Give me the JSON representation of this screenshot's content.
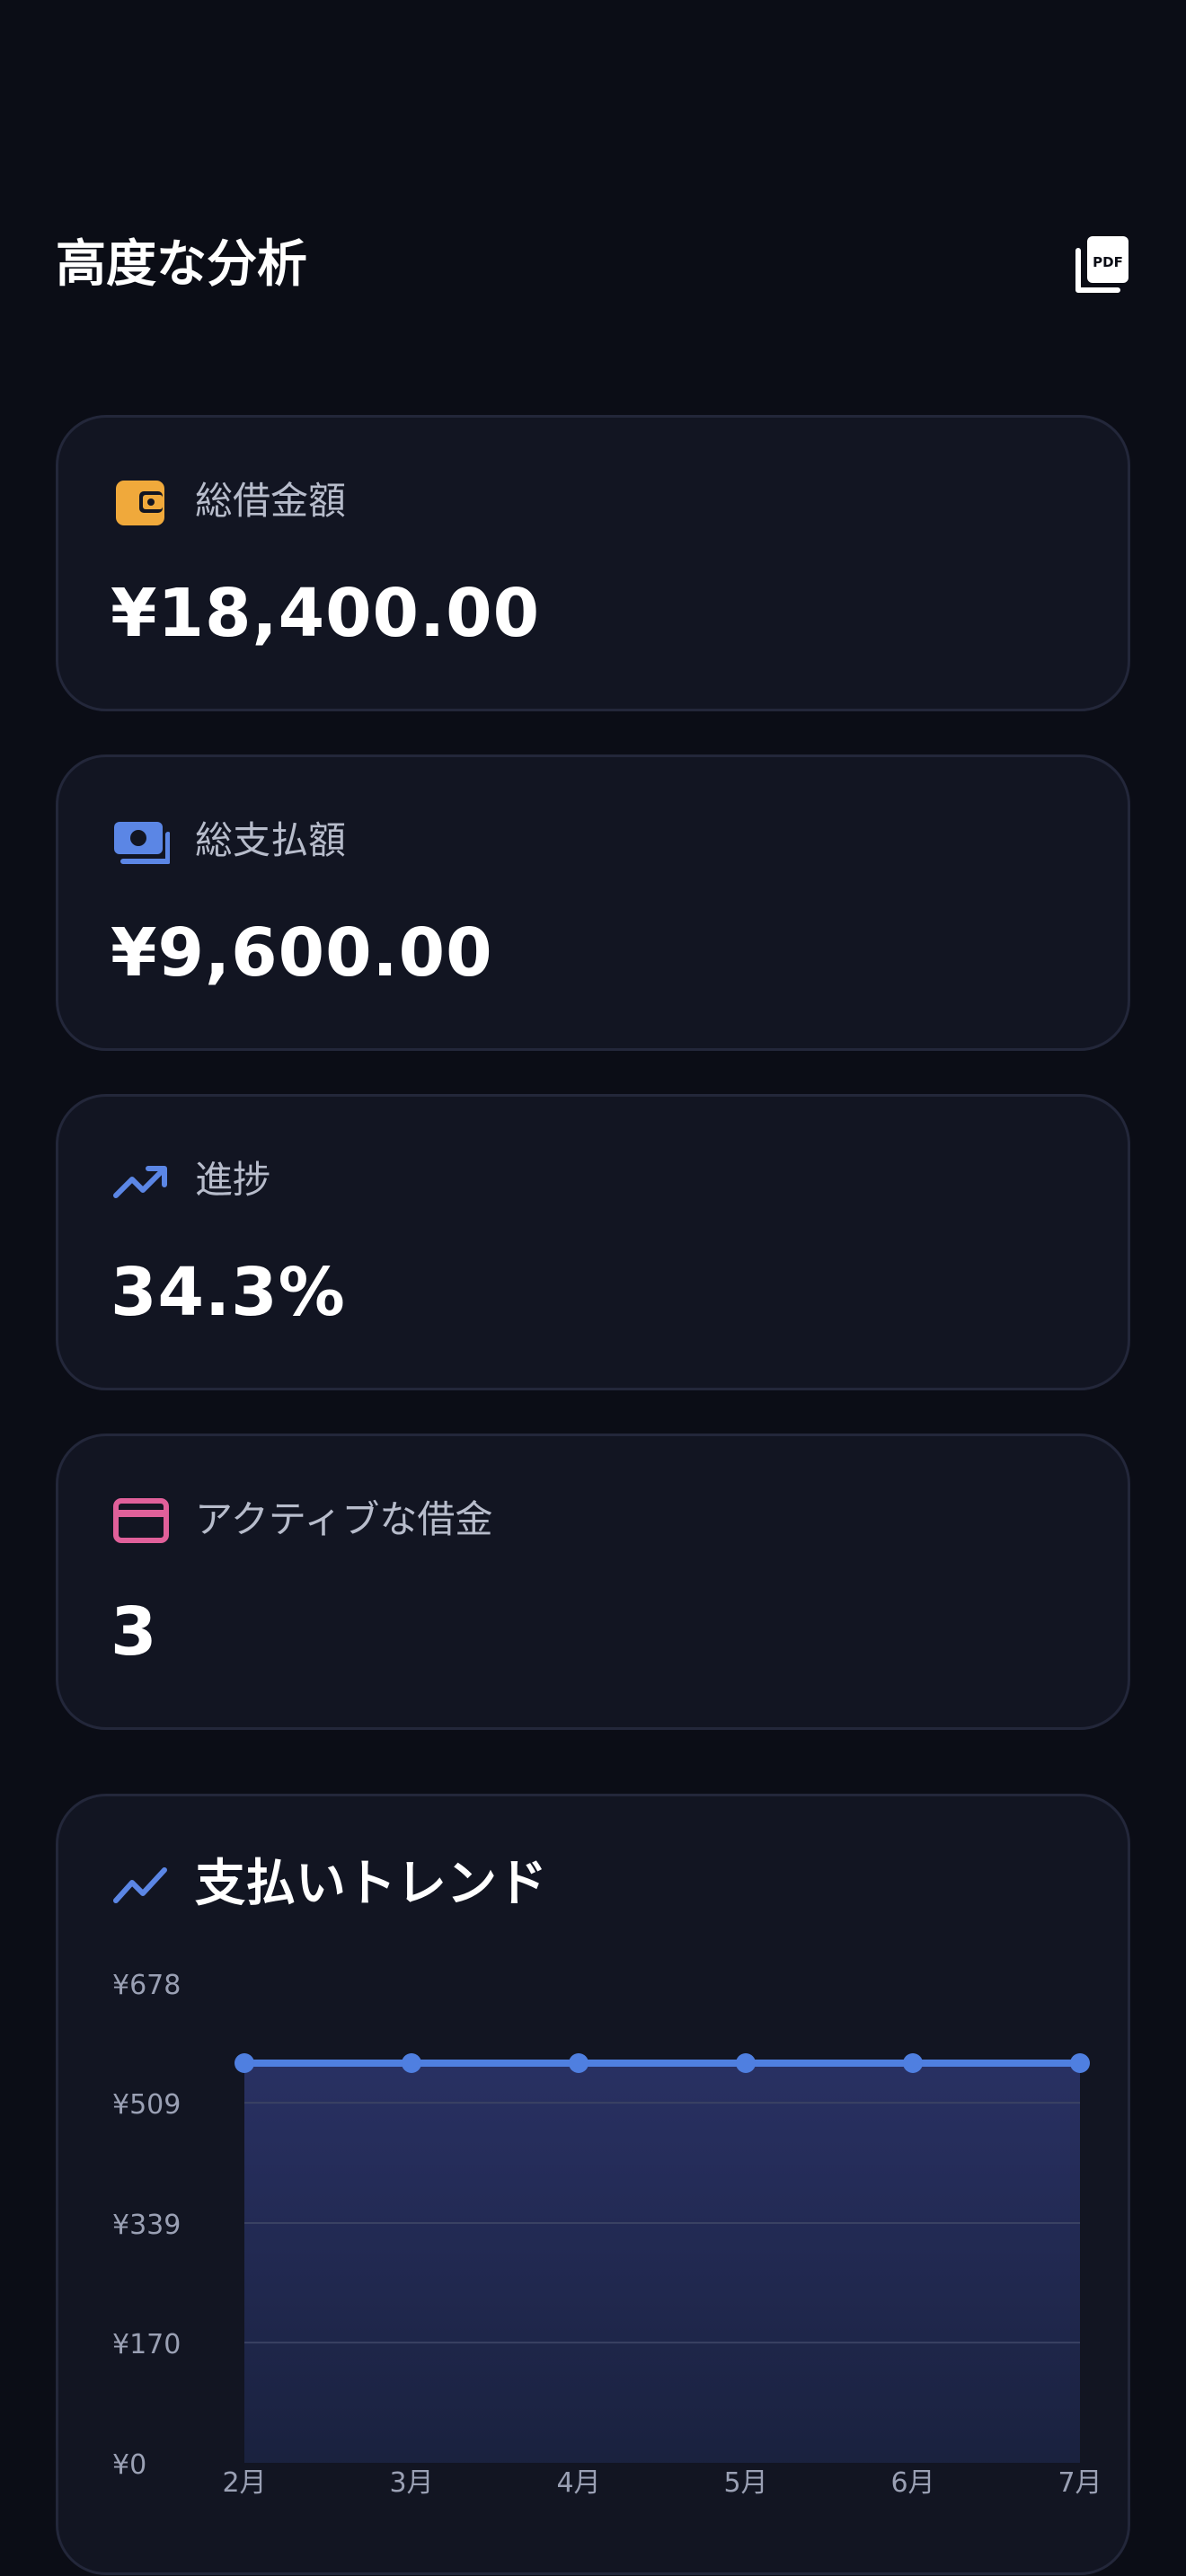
{
  "header": {
    "title": "高度な分析",
    "pdf_icon_text": "PDF"
  },
  "stats": [
    {
      "label": "総借金額",
      "value": "¥18,400.00",
      "icon": "wallet-icon",
      "color": "#f0a93b"
    },
    {
      "label": "総支払額",
      "value": "¥9,600.00",
      "icon": "cash-icon",
      "color": "#5b86e5"
    },
    {
      "label": "進捗",
      "value": "34.3%",
      "icon": "trending-up-icon",
      "color": "#5b86e5"
    },
    {
      "label": "アクティブな借金",
      "value": "3",
      "icon": "credit-card-icon",
      "color": "#e0609a"
    }
  ],
  "chart_card": {
    "title": "支払いトレンド",
    "icon": "trending-up-icon"
  },
  "chart_data": {
    "type": "area",
    "title": "支払いトレンド",
    "categories": [
      "2月",
      "3月",
      "4月",
      "5月",
      "6月",
      "7月"
    ],
    "values": [
      565,
      565,
      565,
      565,
      565,
      565
    ],
    "yticks": [
      "¥678",
      "¥509",
      "¥339",
      "¥170",
      "¥0"
    ],
    "ytick_values": [
      678,
      509,
      339,
      170,
      0
    ],
    "ylim": [
      0,
      678
    ],
    "grid": true,
    "line_color": "#4f7fe0",
    "fill_color": "#2a3266"
  }
}
